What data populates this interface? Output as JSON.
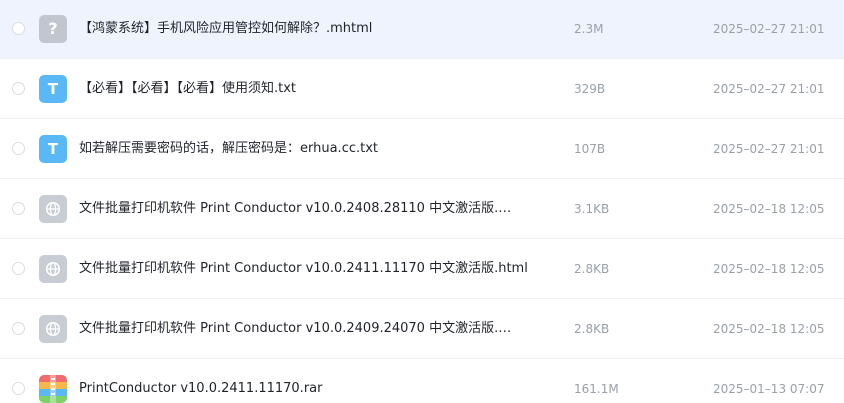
{
  "files": [
    {
      "name": "【鸿蒙系统】手机风险应用管控如何解除？.mhtml",
      "size": "2.3M",
      "date": "2025–02–27 21:01",
      "icon": "unknown-file-icon",
      "icon_glyph": "?"
    },
    {
      "name": "【必看】【必看】【必看】使用须知.txt",
      "size": "329B",
      "date": "2025–02–27 21:01",
      "icon": "text-file-icon",
      "icon_glyph": "T"
    },
    {
      "name": "如若解压需要密码的话，解压密码是：erhua.cc.txt",
      "size": "107B",
      "date": "2025–02–27 21:01",
      "icon": "text-file-icon",
      "icon_glyph": "T"
    },
    {
      "name": "文件批量打印机软件 Print Conductor v10.0.2408.28110 中文激活版.…",
      "size": "3.1KB",
      "date": "2025–02–18 12:05",
      "icon": "web-file-icon"
    },
    {
      "name": "文件批量打印机软件 Print Conductor v10.0.2411.11170 中文激活版.html",
      "size": "2.8KB",
      "date": "2025–02–18 12:05",
      "icon": "web-file-icon"
    },
    {
      "name": "文件批量打印机软件 Print Conductor v10.0.2409.24070 中文激活版.…",
      "size": "2.8KB",
      "date": "2025–02–18 12:05",
      "icon": "web-file-icon"
    },
    {
      "name": "PrintConductor v10.0.2411.11170.rar",
      "size": "161.1M",
      "date": "2025–01–13 07:07",
      "icon": "archive-file-icon"
    }
  ],
  "colors": {
    "selected_row": "#eef3fe",
    "text_icon": "#5bb8f6",
    "unknown_icon": "#c2c6ce",
    "web_icon": "#c8ccd3",
    "meta_text": "#9aa0a8"
  }
}
